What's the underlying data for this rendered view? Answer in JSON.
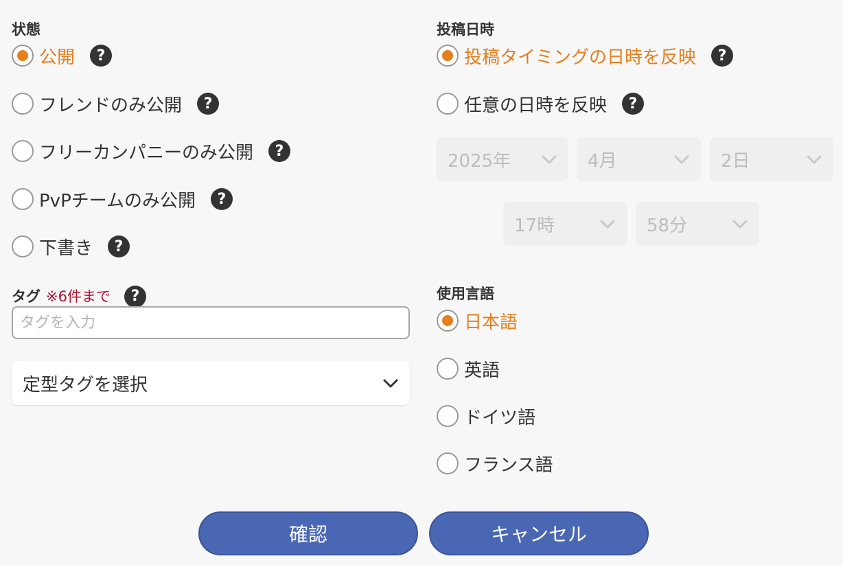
{
  "status": {
    "title": "状態",
    "options": [
      {
        "label": "公開",
        "selected": true
      },
      {
        "label": "フレンドのみ公開",
        "selected": false
      },
      {
        "label": "フリーカンパニーのみ公開",
        "selected": false
      },
      {
        "label": "PvPチームのみ公開",
        "selected": false
      },
      {
        "label": "下書き",
        "selected": false
      }
    ],
    "help_glyph": "?"
  },
  "tags": {
    "title": "タグ",
    "note": "※6件まで",
    "placeholder": "タグを入力",
    "preset_select": "定型タグを選択"
  },
  "post_datetime": {
    "title": "投稿日時",
    "options": [
      {
        "label": "投稿タイミングの日時を反映",
        "selected": true
      },
      {
        "label": "任意の日時を反映",
        "selected": false
      }
    ],
    "year": "2025年",
    "month": "4月",
    "day": "2日",
    "hour": "17時",
    "minute": "58分"
  },
  "language": {
    "title": "使用言語",
    "options": [
      {
        "label": "日本語",
        "selected": true
      },
      {
        "label": "英語",
        "selected": false
      },
      {
        "label": "ドイツ語",
        "selected": false
      },
      {
        "label": "フランス語",
        "selected": false
      }
    ]
  },
  "buttons": {
    "confirm": "確認",
    "cancel": "キャンセル"
  },
  "colors": {
    "accent": "#e47f1c",
    "button": "#4a67b3",
    "note": "#b0142c",
    "help": "#333333"
  },
  "icons": {
    "help": "question-circle-icon",
    "dropdown": "chevron-down-icon"
  }
}
